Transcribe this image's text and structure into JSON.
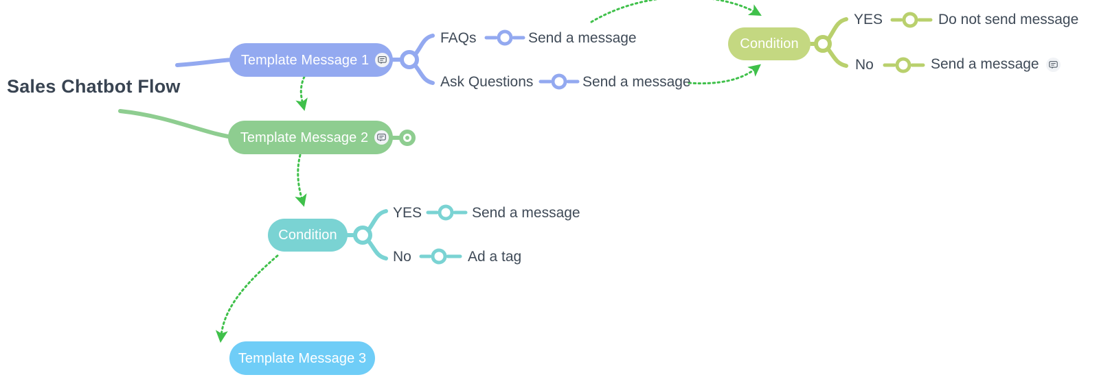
{
  "title": "Sales Chatbot Flow",
  "colors": {
    "blue_node": "#93a9f0",
    "green_node": "#8ecd90",
    "teal_node": "#7ad3d3",
    "olive_node": "#c4d881",
    "lightblue_node": "#6fcdf7",
    "dotted_arrow": "#3fc04a",
    "text": "#3f4a57",
    "title_text": "#394452"
  },
  "nodes": {
    "template_message_1": {
      "label": "Template Message 1",
      "icon": "message-bubble-icon"
    },
    "template_message_2": {
      "label": "Template Message 2",
      "icon": "message-bubble-icon"
    },
    "template_message_3": {
      "label": "Template Message 3"
    },
    "condition_teal": {
      "label": "Condition"
    },
    "condition_olive": {
      "label": "Condition"
    }
  },
  "branches": {
    "tm1": [
      {
        "label": "FAQs",
        "action": "Send a message"
      },
      {
        "label": "Ask Questions",
        "action": "Send a message"
      }
    ],
    "condition_olive": [
      {
        "label": "YES",
        "action": "Do not send message"
      },
      {
        "label": "No",
        "action": "Send a message",
        "icon": "message-bubble-icon"
      }
    ],
    "condition_teal": [
      {
        "label": "YES",
        "action": "Send a message"
      },
      {
        "label": "No",
        "action": "Ad a tag"
      }
    ]
  }
}
